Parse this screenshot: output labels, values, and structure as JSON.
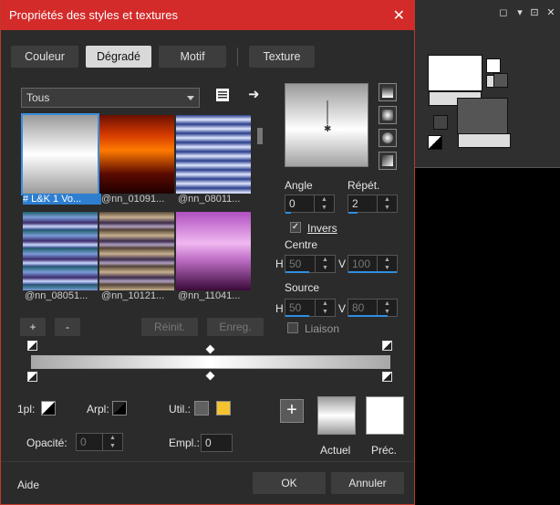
{
  "dialog": {
    "title": "Propriétés des styles et textures",
    "close_glyph": "✕",
    "tabs": [
      {
        "label": "Couleur",
        "active": false
      },
      {
        "label": "Dégradé",
        "active": true
      },
      {
        "label": "Motif",
        "active": false
      },
      {
        "label": "Texture",
        "active": false
      }
    ],
    "category_select": {
      "value": "Tous"
    },
    "gradients": [
      {
        "label": "# L&K 1 Vo...",
        "selected": true
      },
      {
        "label": "@nn_01091..."
      },
      {
        "label": "@nn_08011..."
      },
      {
        "label": "@nn_08051..."
      },
      {
        "label": "@nn_10121..."
      },
      {
        "label": "@nn_11041..."
      }
    ],
    "angle": {
      "label": "Angle",
      "value": "0"
    },
    "repeat": {
      "label": "Répét.",
      "value": "2"
    },
    "invert": {
      "label": "Invers",
      "checked": true
    },
    "center": {
      "label": "Centre",
      "h_label": "H",
      "h_value": "50",
      "v_label": "V",
      "v_value": "100"
    },
    "source": {
      "label": "Source",
      "h_label": "H",
      "h_value": "50",
      "v_label": "V",
      "v_value": "80"
    },
    "link": {
      "label": "Liaison",
      "checked": false
    },
    "buttons": {
      "add": "+",
      "remove": "-",
      "reset": "Réinit.",
      "save": "Enreg.",
      "ok": "OK",
      "cancel": "Annuler",
      "help": "Aide"
    },
    "stops": {
      "first_label": "1pl:",
      "arpl_label": "Arpl:",
      "util_label": "Util.:",
      "opacity_label": "Opacité:",
      "opacity_value": "0",
      "empl_label": "Empl.:",
      "empl_value": "0",
      "util_color_a": "#606060",
      "util_color_b": "#f4c430"
    },
    "previews": {
      "current_label": "Actuel",
      "prev_label": "Préc.",
      "add_glyph": "+"
    }
  },
  "background_app": {
    "controls": [
      "◻",
      "☐",
      "▾",
      "⊡",
      "✕"
    ]
  },
  "colors": {
    "accent": "#d32a2a",
    "selection": "#2f7fd0"
  }
}
